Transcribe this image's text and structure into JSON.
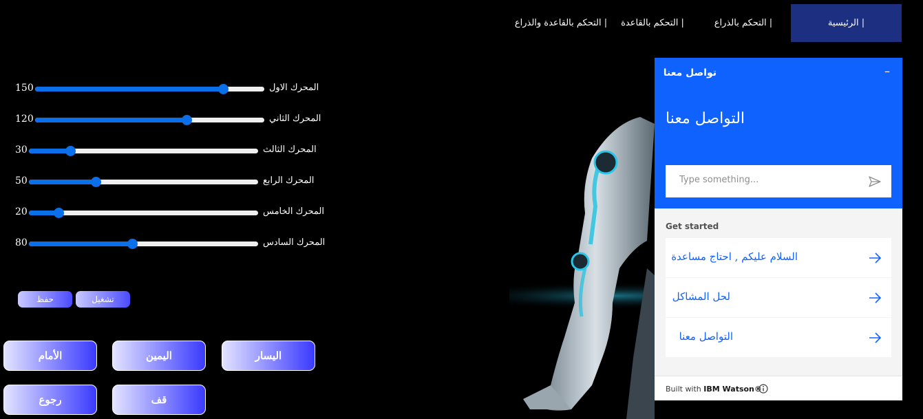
{
  "nav": {
    "items": [
      {
        "label": "الرئيسية |",
        "active": true
      },
      {
        "label": "التحكم بالذراع |",
        "active": false
      },
      {
        "label": "التحكم بالقاعدة |",
        "active": false
      },
      {
        "label": "التحكم بالقاعدة والذراع |",
        "active": false
      }
    ]
  },
  "sliders": [
    {
      "label": "المحرك الاول",
      "value": "150",
      "level": 0.82
    },
    {
      "label": "المحرك الثاني",
      "value": "120",
      "level": 0.66
    },
    {
      "label": "المحرك الثالث",
      "value": "30",
      "level": 0.18
    },
    {
      "label": "المحرك الرابع",
      "value": "50",
      "level": 0.29
    },
    {
      "label": "المحرك الخامس",
      "value": "20",
      "level": 0.13
    },
    {
      "label": "المحرك السادس",
      "value": "80",
      "level": 0.45
    }
  ],
  "actions": {
    "save": "حفظ",
    "run": "تشغيل"
  },
  "controls": {
    "forward": "الأمام",
    "right": "اليمين",
    "left": "اليسار",
    "back": "رجوع",
    "stop": "قف"
  },
  "chat": {
    "title": "تواصل معنا",
    "minimize": "–",
    "heading": "التواصل معنا",
    "input_placeholder": "Type something...",
    "get_started": "Get started",
    "options": [
      "السلام عليكم , احتاج مساعدة",
      "لحل المشاكل",
      "التواصل معنا"
    ],
    "footer_prefix": "Built with ",
    "footer_brand": "IBM Watson®",
    "accent": "#0f62fe"
  },
  "colors": {
    "background": "#000000",
    "nav_active": "#1c2f80",
    "slider": "#0a6fe8"
  },
  "icons": [
    "send-icon",
    "arrow-right-icon",
    "info-icon",
    "minimize-icon"
  ]
}
